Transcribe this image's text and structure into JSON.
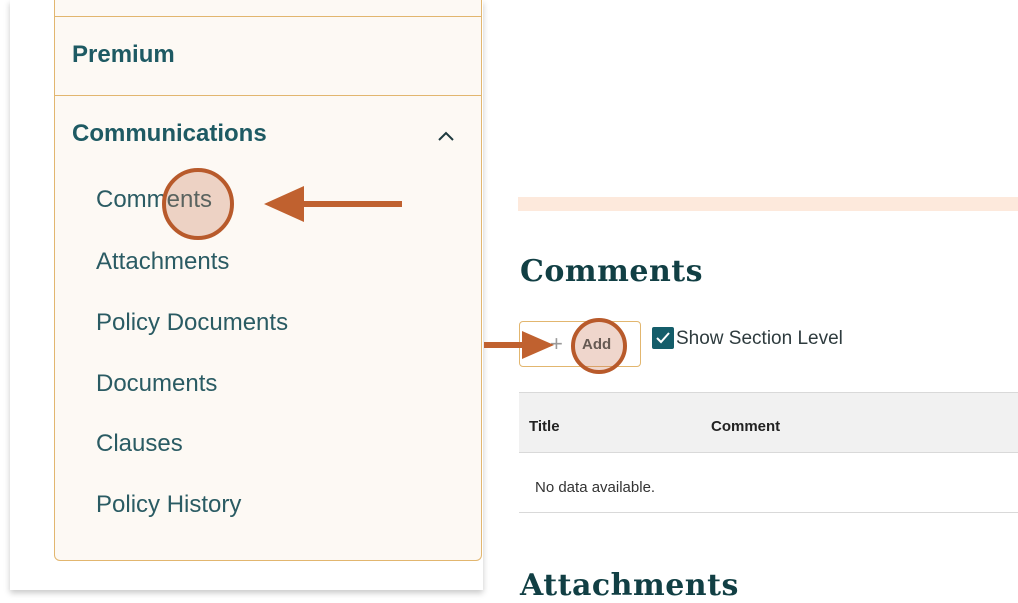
{
  "sidebar": {
    "premium_label": "Premium",
    "communications_label": "Communications",
    "items": [
      {
        "label": "Comments"
      },
      {
        "label": "Attachments"
      },
      {
        "label": "Policy Documents"
      },
      {
        "label": "Documents"
      },
      {
        "label": "Clauses"
      },
      {
        "label": "Policy History"
      }
    ]
  },
  "comments_section": {
    "heading": "Comments",
    "add_icon": "plus-icon",
    "add_label": "Add",
    "show_section_level_label": "Show Section Level",
    "show_section_level_checked": true,
    "table": {
      "columns": [
        "Title",
        "Comment"
      ],
      "empty_text": "No data available."
    }
  },
  "attachments_section": {
    "heading": "Attachments"
  },
  "annotations": {
    "arrow_color": "#c0612f",
    "highlight_color": "#b85a2b"
  }
}
